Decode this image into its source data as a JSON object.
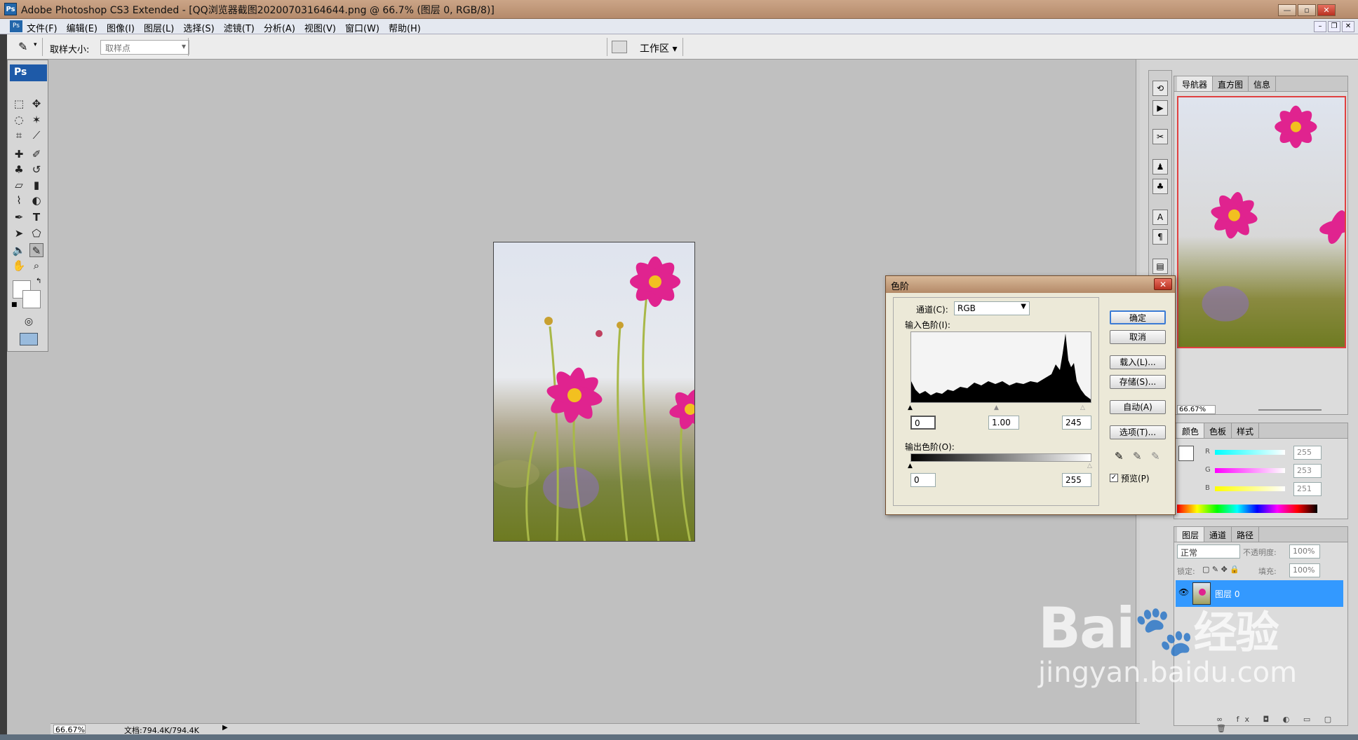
{
  "app": {
    "title": "Adobe Photoshop CS3 Extended - [QQ浏览器截图20200703164644.png @ 66.7% (图层 0, RGB/8)]"
  },
  "menu": {
    "items": [
      "文件(F)",
      "编辑(E)",
      "图像(I)",
      "图层(L)",
      "选择(S)",
      "滤镜(T)",
      "分析(A)",
      "视图(V)",
      "窗口(W)",
      "帮助(H)"
    ]
  },
  "options": {
    "sample_size_label": "取样大小:",
    "sample_size_value": "取样点",
    "workspace_label": "工作区 ▾"
  },
  "toolbox": {
    "header": "Ps"
  },
  "navigator": {
    "tabs": [
      "导航器",
      "直方图",
      "信息"
    ],
    "zoom": "66.67%"
  },
  "color": {
    "tabs": [
      "颜色",
      "色板",
      "样式"
    ],
    "r": "255",
    "g": "253",
    "b": "251",
    "r_label": "R",
    "g_label": "G",
    "b_label": "B"
  },
  "layers": {
    "tabs": [
      "图层",
      "通道",
      "路径"
    ],
    "blend": "正常",
    "opacity_label": "不透明度:",
    "opacity": "100%",
    "lock_label": "锁定:",
    "fill_label": "填充:",
    "fill": "100%",
    "layer_name": "图层 0"
  },
  "levels": {
    "title": "色阶",
    "channel_label": "通道(C):",
    "channel": "RGB",
    "input_label": "输入色阶(I):",
    "input_black": "0",
    "input_gamma": "1.00",
    "input_white": "245",
    "output_label": "输出色阶(O):",
    "output_black": "0",
    "output_white": "255",
    "ok": "确定",
    "cancel": "取消",
    "load": "载入(L)...",
    "save": "存储(S)...",
    "auto": "自动(A)",
    "options": "选项(T)...",
    "preview": "预览(P)"
  },
  "status": {
    "zoom": "66.67%",
    "doc": "文档:794.4K/794.4K"
  },
  "watermark": {
    "brand": "Bai",
    "brand2": "经验",
    "url": "jingyan.baidu.com"
  },
  "colors": {
    "accent": "#3399ff",
    "magenta": "#e0238f"
  }
}
